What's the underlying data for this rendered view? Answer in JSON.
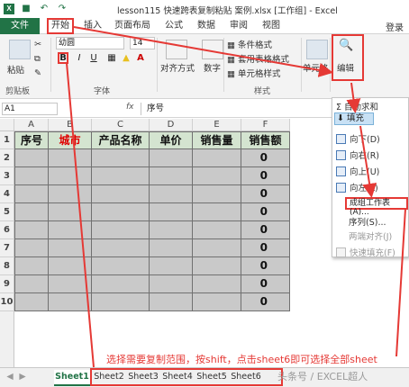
{
  "window": {
    "title": "lesson115 快速跨表复制粘贴 案例.xlsx [工作组] - Excel",
    "app_logo": "X"
  },
  "quick_access": [
    "save-icon",
    "undo-icon",
    "redo-icon"
  ],
  "ribbon_tabs": [
    "文件",
    "开始",
    "插入",
    "页面布局",
    "公式",
    "数据",
    "审阅",
    "视图"
  ],
  "sign_in": "登录",
  "ribbon": {
    "clipboard": {
      "paste": "粘贴",
      "label": "剪贴板"
    },
    "font": {
      "name": "幼圆",
      "size": "14",
      "bold": "B",
      "italic": "I",
      "underline": "U",
      "label": "字体"
    },
    "alignment": {
      "label": "对齐方式"
    },
    "number": {
      "label": "数字"
    },
    "styles": {
      "conditional": "条件格式",
      "table": "套用表格格式",
      "cell": "单元格样式",
      "label": "样式"
    },
    "cells": {
      "label": "单元格"
    },
    "editing": {
      "label": "编辑"
    }
  },
  "formula_bar": {
    "name_box": "A1",
    "fx": "fx",
    "value": "序号"
  },
  "columns": [
    "A",
    "B",
    "C",
    "D",
    "E",
    "F"
  ],
  "rows": [
    "1",
    "2",
    "3",
    "4",
    "5",
    "6",
    "7",
    "8",
    "9",
    "10"
  ],
  "table": {
    "headers": [
      "序号",
      "城市",
      "产品名称",
      "单价",
      "销售量",
      "销售额"
    ],
    "sales_values": [
      "0",
      "0",
      "0",
      "0",
      "0",
      "0",
      "0",
      "0",
      "0"
    ]
  },
  "editing_menu": {
    "autosum": "自动求和",
    "fill": "填充",
    "items": [
      "向下(D)",
      "向右(R)",
      "向上(U)",
      "向左(L)"
    ],
    "across": "成组工作表(A)...",
    "series": "序列(S)...",
    "justify": "两端对齐(J)",
    "flash": "快速填充(F)"
  },
  "sheets": [
    "Sheet1",
    "Sheet2",
    "Sheet3",
    "Sheet4",
    "Sheet5",
    "Sheet6"
  ],
  "annotation": "选择需要复制范围，按shift，点击sheet6即可选择全部sheet",
  "watermark": "头条号 / EXCEL超人",
  "colors": {
    "excel_green": "#217346",
    "highlight_red": "#e53935",
    "header_fill": "#d4e4d0",
    "body_fill": "#c9c9c9"
  }
}
